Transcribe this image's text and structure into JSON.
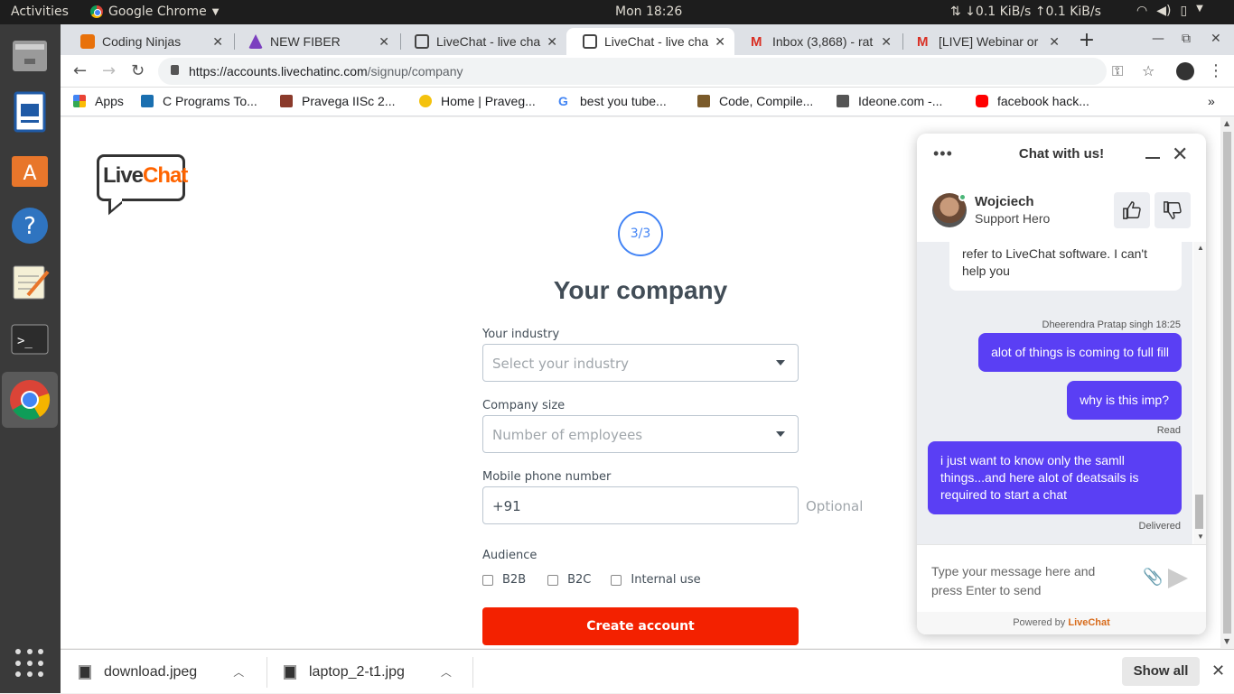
{
  "system": {
    "activities": "Activities",
    "app_name": "Google Chrome",
    "clock": "Mon 18:26",
    "netspeed": "⇅ ↓0.1 KiB/s ↑0.1 KiB/s"
  },
  "tabs": [
    {
      "title": "Coding Ninjas",
      "color": "#e8710a"
    },
    {
      "title": "NEW FIBER",
      "color": "#7b3fbf"
    },
    {
      "title": "LiveChat - live cha",
      "color": "#444444"
    },
    {
      "title": "LiveChat - live cha",
      "color": "#444444"
    },
    {
      "title": "Inbox (3,868) - rat",
      "color": "#d93025"
    },
    {
      "title": "[LIVE] Webinar or",
      "color": "#d93025"
    }
  ],
  "address": {
    "host": "https://accounts.livechatinc.com",
    "path": "/signup/company"
  },
  "bookmarks": [
    {
      "label": "Apps",
      "color": "#ea4335"
    },
    {
      "label": "C Programs To...",
      "color": "#1a6fb0"
    },
    {
      "label": "Pravega IISc 2...",
      "color": "#8b3a2b"
    },
    {
      "label": "Home | Praveg...",
      "color": "#f4c20d"
    },
    {
      "label": "best you tube...",
      "color": "#4285f4"
    },
    {
      "label": "Code, Compile...",
      "color": "#7a5a2a"
    },
    {
      "label": "Ideone.com -...",
      "color": "#555555"
    },
    {
      "label": "facebook hack...",
      "color": "#ff0000"
    }
  ],
  "form": {
    "logo_part1": "Live",
    "logo_part2": "Chat",
    "step": "3/3",
    "heading": "Your company",
    "industry_label": "Your industry",
    "industry_placeholder": "Select your industry",
    "size_label": "Company size",
    "size_placeholder": "Number of employees",
    "phone_label": "Mobile phone number",
    "phone_value": "+91",
    "optional": "Optional",
    "audience_label": "Audience",
    "audience_options": [
      "B2B",
      "B2C",
      "Internal use"
    ],
    "submit": "Create account"
  },
  "chat": {
    "title": "Chat with us!",
    "agent_name": "Wojciech",
    "agent_role": "Support Hero",
    "agent_message": "refer to LiveChat software. I can't help you",
    "sender": "Dheerendra Pratap singh 18:25",
    "msg1": "alot of things is coming to full fill",
    "msg2": "why is this imp?",
    "read": "Read",
    "msg3": "i just want to know only the samll things...and here alot of deatsails is required to start a chat",
    "delivered": "Delivered",
    "composer_placeholder": "Type your message here and press Enter to send",
    "powered_by": "Powered by",
    "powered_brand": "LiveChat"
  },
  "downloads": {
    "file1": "download.jpeg",
    "file2": "laptop_2-t1.jpg",
    "show_all": "Show all"
  }
}
